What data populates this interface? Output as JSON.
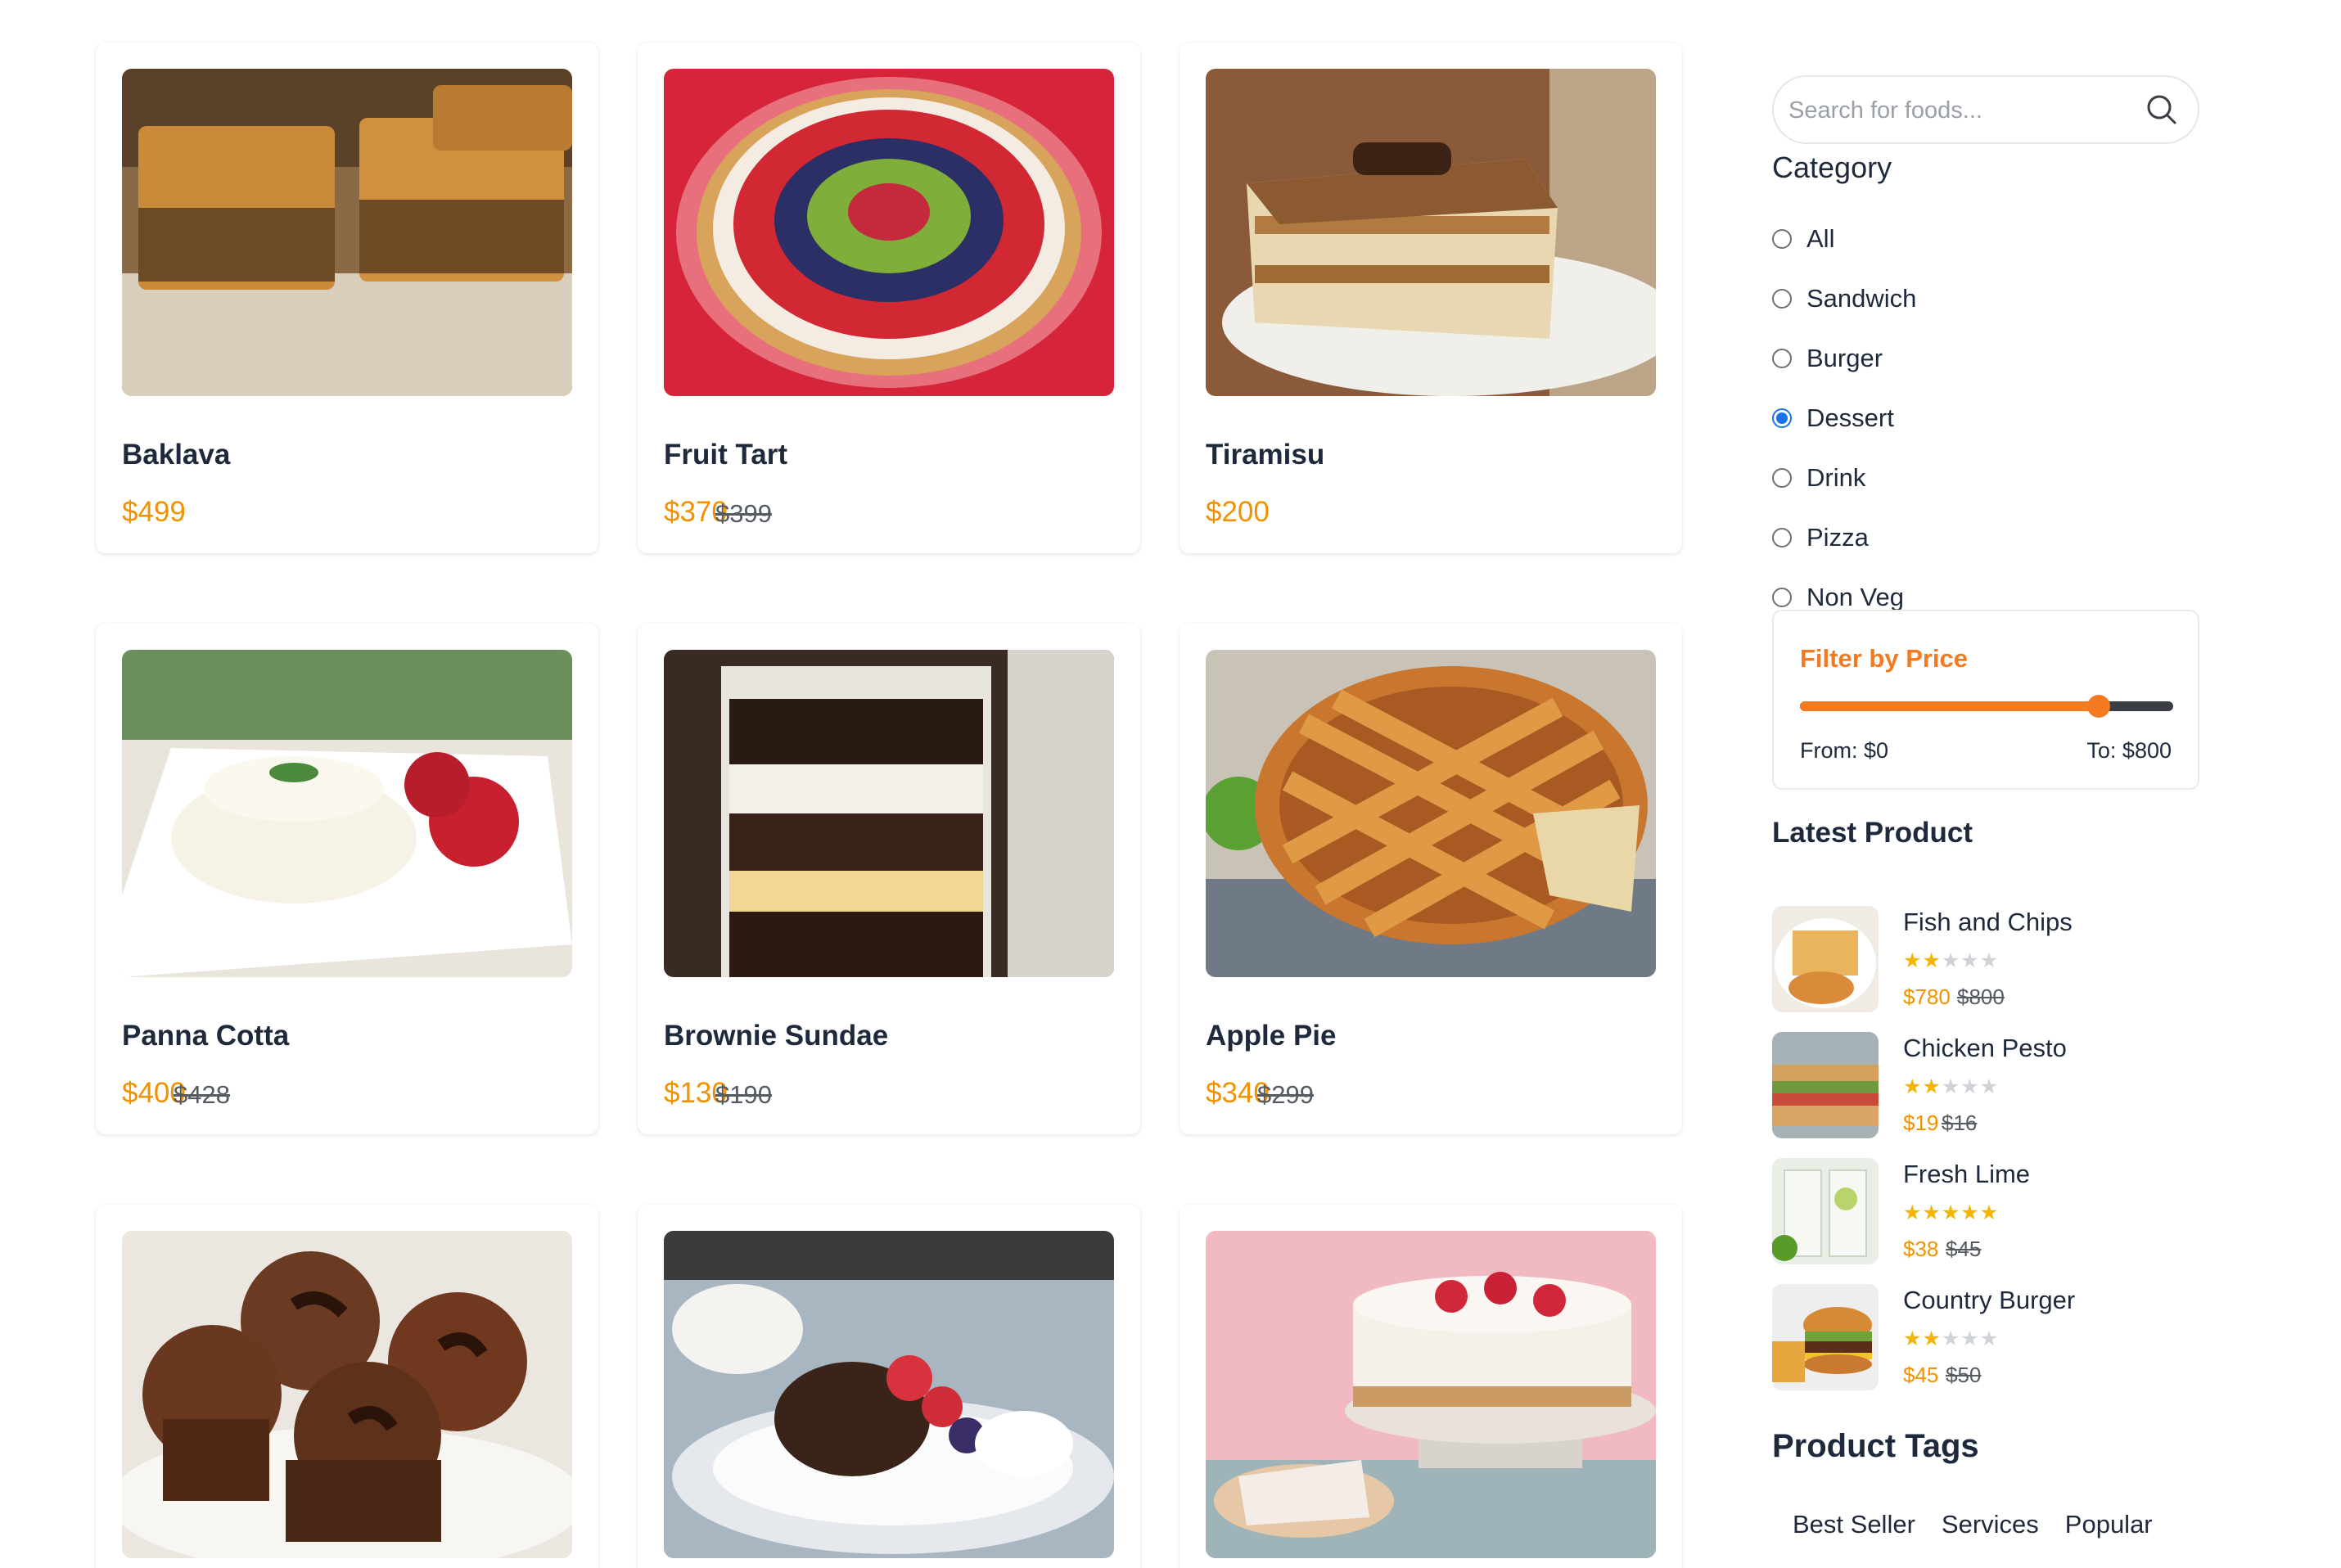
{
  "products": [
    {
      "name": "Baklava",
      "price": "$499",
      "old_price": ""
    },
    {
      "name": "Fruit Tart",
      "price": "$370",
      "old_price": "$399"
    },
    {
      "name": "Tiramisu",
      "price": "$200",
      "old_price": ""
    },
    {
      "name": "Panna Cotta",
      "price": "$400",
      "old_price": "$428"
    },
    {
      "name": "Brownie Sundae",
      "price": "$130",
      "old_price": "$190"
    },
    {
      "name": "Apple Pie",
      "price": "$340",
      "old_price": "$299"
    },
    {
      "name": "",
      "price": "",
      "old_price": ""
    },
    {
      "name": "",
      "price": "",
      "old_price": ""
    },
    {
      "name": "",
      "price": "",
      "old_price": ""
    }
  ],
  "sidebar": {
    "search": {
      "placeholder": "Search for foods...",
      "icon": "search-icon"
    },
    "category": {
      "title": "Category",
      "options": [
        "All",
        "Sandwich",
        "Burger",
        "Dessert",
        "Drink",
        "Pizza",
        "Non Veg"
      ],
      "selected": "Dessert"
    },
    "price_filter": {
      "title": "Filter by Price",
      "from_label": "From: $0",
      "to_label": "To: $800",
      "level_percent": 80,
      "accent": "#f47a20"
    },
    "latest": {
      "title": "Latest Product",
      "items": [
        {
          "name": "Fish and Chips",
          "rating": 2,
          "price": "$780",
          "old_price": "$800"
        },
        {
          "name": "Chicken Pesto",
          "rating": 2,
          "price": "$19",
          "old_price": "$16"
        },
        {
          "name": "Fresh Lime",
          "rating": 5,
          "price": "$38",
          "old_price": "$45"
        },
        {
          "name": "Country Burger",
          "rating": 2,
          "price": "$45",
          "old_price": "$50"
        }
      ]
    },
    "tags": {
      "title": "Product Tags",
      "items": [
        "Best Seller",
        "Services",
        "Popular"
      ]
    }
  },
  "colors": {
    "price": "#f39200",
    "accent": "#f47a20",
    "radio_checked": "#1a73e8",
    "text": "#1e2a3b"
  }
}
